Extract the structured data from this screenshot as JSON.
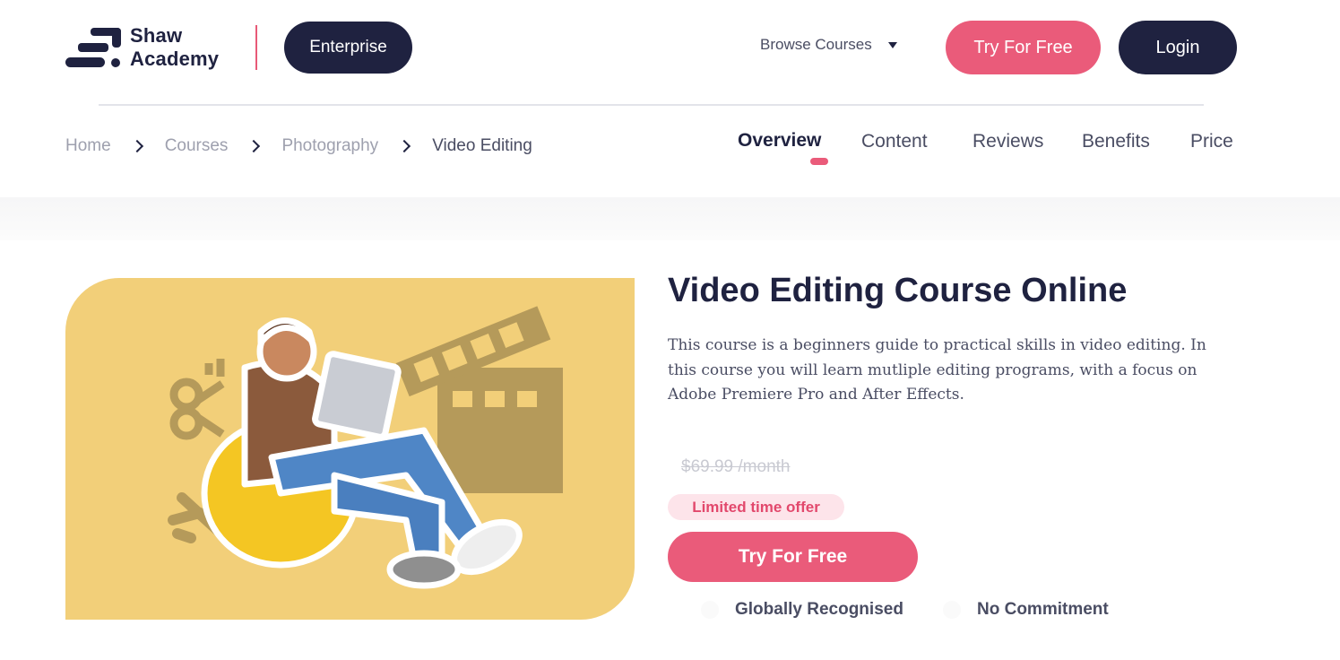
{
  "brand": {
    "name_line1": "Shaw",
    "name_line2": "Academy",
    "logo_icon": "shaw-academy-logo-icon",
    "accent_color": "#ea5b7a",
    "dark_color": "#1f2240"
  },
  "header": {
    "enterprise_label": "Enterprise",
    "browse_label": "Browse Courses",
    "try_label": "Try For Free",
    "login_label": "Login"
  },
  "breadcrumb": {
    "items": [
      "Home",
      "Courses",
      "Photography",
      "Video Editing"
    ],
    "separator_icon": "chevron-right-icon"
  },
  "tabs": {
    "items": [
      "Overview",
      "Content",
      "Reviews",
      "Benefits",
      "Price"
    ],
    "active": "Overview"
  },
  "course": {
    "title": "Video Editing Course Online",
    "description": "This course is a beginners guide to practical skills in video editing. In this course you will learn mutliple editing programs, with a focus on Adobe Premiere Pro and After Effects.",
    "old_price": "$69.99 /month",
    "offer_badge": "Limited time offer",
    "cta_label": "Try For Free",
    "features": [
      "Globally Recognised",
      "No Commitment"
    ]
  },
  "hero_image": {
    "icons": [
      "scissors-icon",
      "clapperboard-icon",
      "film-strip-icon",
      "wrench-icon"
    ]
  }
}
